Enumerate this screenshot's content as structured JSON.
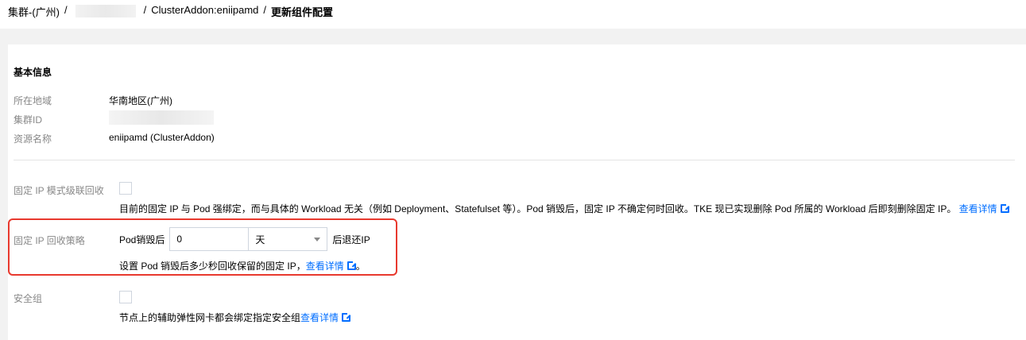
{
  "breadcrumb": {
    "cluster": "集群-(广州)",
    "separator": "/",
    "addon": "ClusterAddon:eniipamd",
    "current": "更新组件配置"
  },
  "basic_info": {
    "title": "基本信息",
    "region_label": "所在地域",
    "region_value": "华南地区(广州)",
    "cluster_id_label": "集群ID",
    "resource_name_label": "资源名称",
    "resource_name_value": "eniipamd (ClusterAddon)"
  },
  "form": {
    "cascade_label": "固定 IP 模式级联回收",
    "cascade_desc": "目前的固定 IP 与 Pod 强绑定，而与具体的 Workload 无关（例如 Deployment、Statefulset 等）。Pod 销毁后，固定 IP 不确定何时回收。TKE 现已实现删除 Pod 所属的 Workload 后即刻删除固定 IP。",
    "cascade_link": "查看详情",
    "policy_label": "固定 IP 回收策略",
    "policy_prefix": "Pod销毁后",
    "policy_value": "0",
    "policy_unit": "天",
    "policy_suffix": "后退还IP",
    "policy_desc": "设置 Pod 销毁后多少秒回收保留的固定 IP，",
    "policy_link": "查看详情",
    "policy_desc_end": "。",
    "sg_label": "安全组",
    "sg_desc": "节点上的辅助弹性网卡都会绑定指定安全组",
    "sg_link": "查看详情"
  },
  "colors": {
    "link": "#006eff",
    "highlight_border": "#e8392e",
    "label_gray": "#888888"
  }
}
